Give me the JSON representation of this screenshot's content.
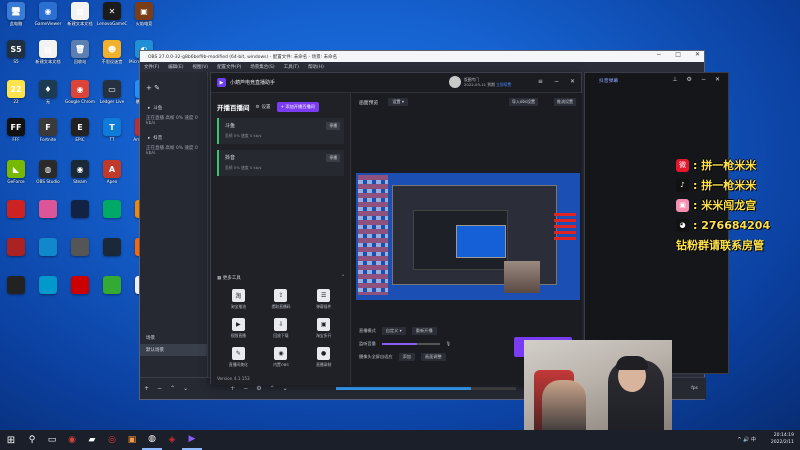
{
  "desktop": {
    "icons": [
      {
        "label": "此电脑",
        "glyph": "🖥",
        "color": "#3a7bd5"
      },
      {
        "label": "GameViewer",
        "glyph": "◉",
        "color": "#2a6fd1"
      },
      {
        "label": "新建文本文档",
        "glyph": "▤",
        "color": "#f3f3f3"
      },
      {
        "label": "LenovoGameCenter",
        "glyph": "✕",
        "color": "#1b1b1b"
      },
      {
        "label": "火焰电竞",
        "glyph": "▣",
        "color": "#7a3d18"
      },
      {
        "label": "S5",
        "glyph": "S5",
        "color": "#203040"
      },
      {
        "label": "新建文本文档",
        "glyph": "▤",
        "color": "#f3f3f3"
      },
      {
        "label": "回收站",
        "glyph": "🗑",
        "color": "#5a7fb0"
      },
      {
        "label": "不思议迷宫",
        "glyph": "☻",
        "color": "#f2b12c"
      },
      {
        "label": "Microsoft Edge",
        "glyph": "◐",
        "color": "#1f8fd6"
      },
      {
        "label": "22",
        "glyph": "22",
        "color": "#ffe34d"
      },
      {
        "label": "无",
        "glyph": "♦",
        "color": "#1c3b53"
      },
      {
        "label": "Google Chrome",
        "glyph": "◉",
        "color": "#db4437"
      },
      {
        "label": "Ledger Live",
        "glyph": "▭",
        "color": "#26303f"
      },
      {
        "label": "暴雪战网",
        "glyph": "◎",
        "color": "#1c91ff"
      },
      {
        "label": "FFF",
        "glyph": "FF",
        "color": "#111"
      },
      {
        "label": "Fortnite",
        "glyph": "F",
        "color": "#3a3a3a"
      },
      {
        "label": "EPIC",
        "glyph": "E",
        "color": "#222"
      },
      {
        "label": "TT",
        "glyph": "T",
        "color": "#0e7bd8"
      },
      {
        "label": "Among Us",
        "glyph": "◖",
        "color": "#c32a2a"
      },
      {
        "label": "GeForce",
        "glyph": "◣",
        "color": "#76b900"
      },
      {
        "label": "OBS Studio",
        "glyph": "◍",
        "color": "#2a2a2a"
      },
      {
        "label": "Steam",
        "glyph": "◉",
        "color": "#1b2838"
      },
      {
        "label": "Apex",
        "glyph": "A",
        "color": "#c0392b"
      }
    ]
  },
  "obs": {
    "title": "OBS 27.0.0-32-g8b6bef9b-modified (64-bit, windows) - 配置文件: 未命名 - 场景: 未命名",
    "menu": [
      "文件(F)",
      "编辑(E)",
      "视图(V)",
      "配置文件(P)",
      "场景集合(S)",
      "工具(T)",
      "帮助(H)"
    ],
    "scenes_header": "场景",
    "sources": [
      {
        "icon": "+",
        "label": ""
      },
      {
        "icon": "斗鱼",
        "label": "斗鱼"
      },
      {
        "icon": "",
        "label": "正在直播 高帧 0% 速度 0 kb/s"
      },
      {
        "icon": "抖音",
        "label": "抖音"
      },
      {
        "icon": "",
        "label": "正在直播 高帧 0% 速度 0 kb/s"
      }
    ],
    "default_scene": "默认场景",
    "mixer_label": "混音",
    "bottom_controls": [
      "+",
      "−",
      "⌃",
      "⌄"
    ],
    "status_right": "fps"
  },
  "assistant": {
    "app_title": "小葫芦电竞直播助手",
    "user_name": "饭圈专门",
    "user_date": "2022-03-11 到期",
    "user_upgrade": "立即续费",
    "live_title": "开播百播间",
    "settings_label": "设置",
    "add_platform": "+ 添加开播百播间",
    "platforms": [
      {
        "name": "斗鱼",
        "stats": "丢帧 0%  速度 0 kb/s",
        "btn": "停播"
      },
      {
        "name": "抖音",
        "stats": "丢帧 0%  速度 0 kb/s",
        "btn": "停播"
      }
    ],
    "tools_title": "更多工具",
    "tools": [
      {
        "label": "淘宝推流",
        "glyph": "淘"
      },
      {
        "label": "提取直播码",
        "glyph": "⇪"
      },
      {
        "label": "弹幕插件",
        "glyph": "☰"
      },
      {
        "label": "视频直播",
        "glyph": "▶"
      },
      {
        "label": "回放下载",
        "glyph": "⇩"
      },
      {
        "label": "淘宝多开",
        "glyph": "▣"
      },
      {
        "label": "直播间美化",
        "glyph": "✎"
      },
      {
        "label": "内置OBS",
        "glyph": "◉"
      },
      {
        "label": "直播录制",
        "glyph": "●"
      }
    ],
    "version": "Version 4.1.153",
    "preview_title": "画面预览",
    "preview_dropdown": "设置",
    "preview_btn1": "导入obs设置",
    "preview_btn2": "推流设置",
    "ctl_stream_label": "直播模式",
    "ctl_stream_value": "自定义",
    "ctl_stream_btn": "重新开播",
    "ctl_volume_label": "监听音量",
    "ctl_volume_level": 0.6,
    "ctl_camera_label": "摄像头全屏自适应",
    "ctl_camera_btn1": "添加",
    "ctl_camera_btn2": "画面调整",
    "footer_left": "关于/帮助",
    "footer_right": "成功加入直播间 一键开播"
  },
  "comments": {
    "title": "抖音弹幕"
  },
  "overlay": {
    "weibo": "拼一枪米米",
    "douyin": "拼一枪米米",
    "bili": "米米闯龙宫",
    "qq": "276684204",
    "fan_group": "钻粉群请联系房管"
  },
  "taskbar": {
    "time": "20:14:19",
    "date": "2022/2/11",
    "tray": "^ 🔊 中"
  }
}
